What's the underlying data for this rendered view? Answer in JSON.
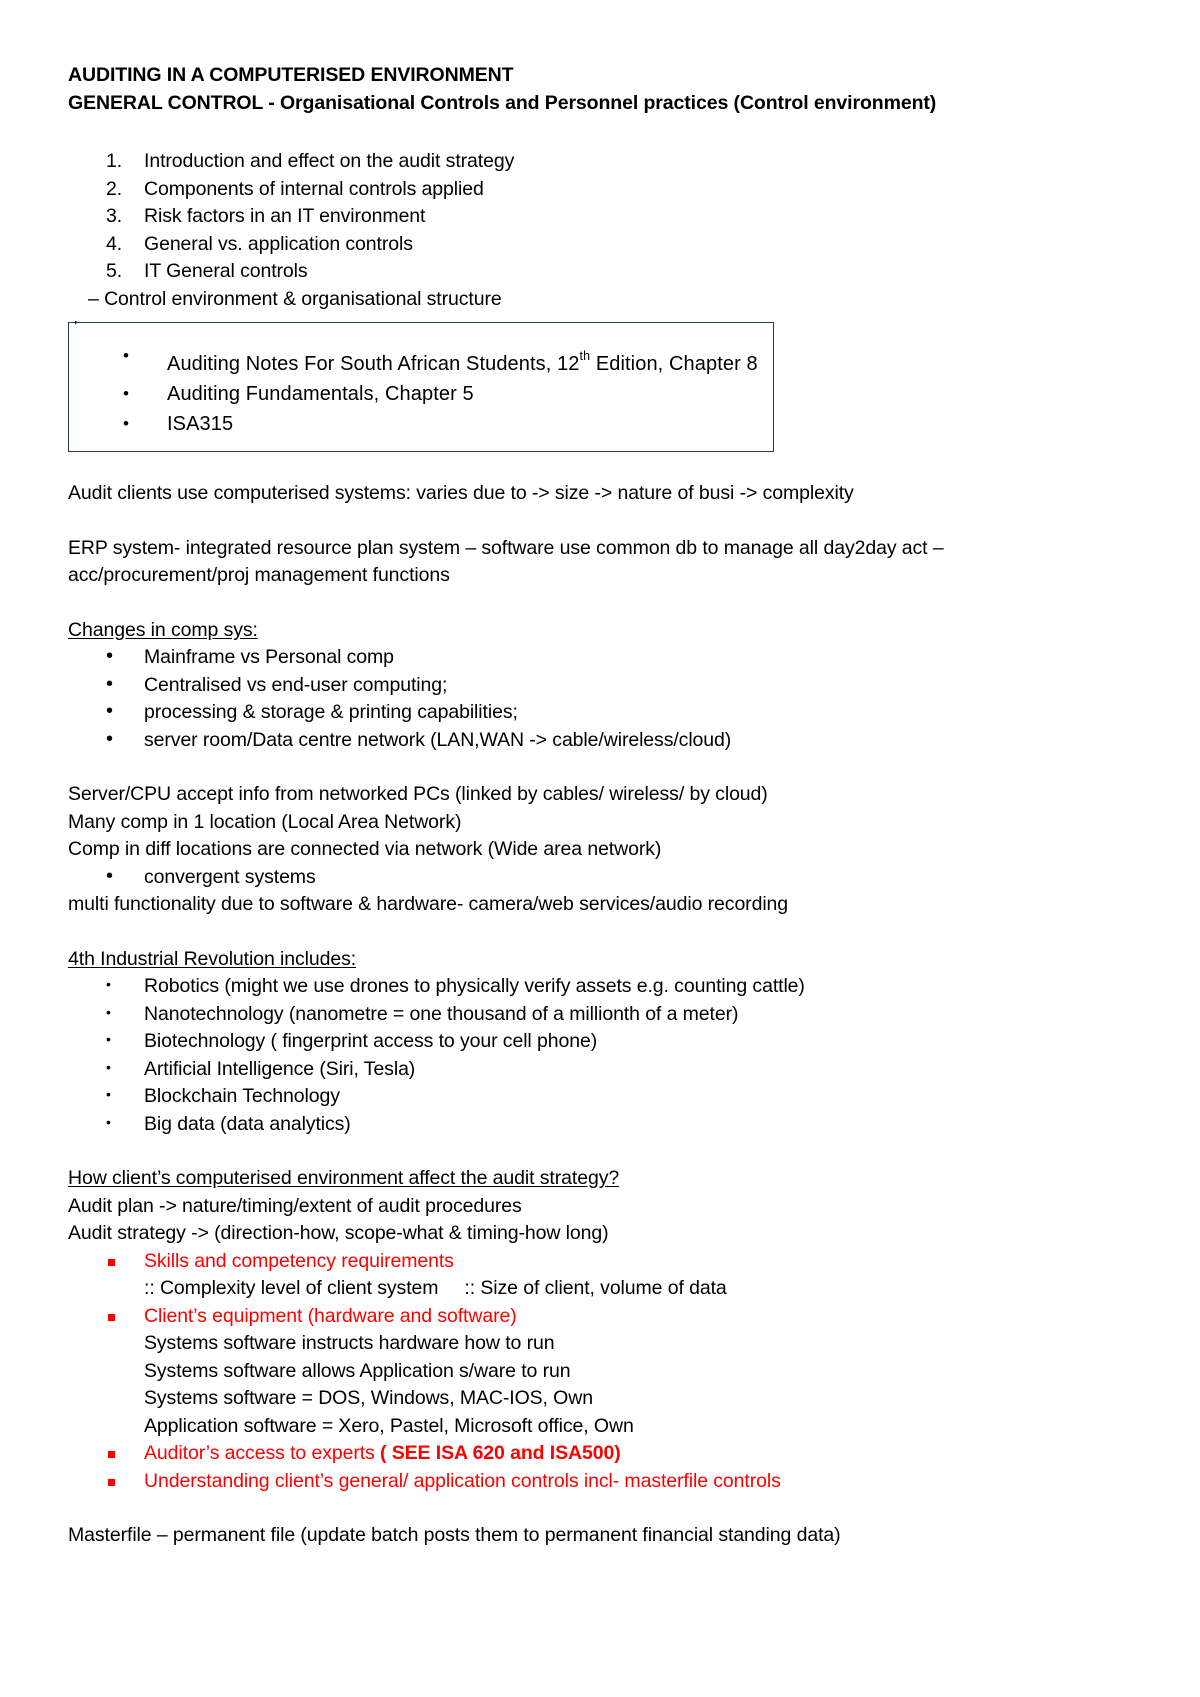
{
  "document": {
    "title_line_1": "AUDITING IN A COMPUTERISED ENVIRONMENT",
    "title_line_2": "GENERAL CONTROL - Organisational Controls and Personnel practices (Control environment)",
    "agenda": {
      "items": [
        "Introduction and effect on the audit strategy",
        "Components of internal controls applied",
        "Risk factors in an IT environment",
        "General vs. application controls",
        "IT General controls"
      ],
      "dash_item": "– Control environment & organisational structure"
    },
    "reference_box": {
      "tick_mark": "’",
      "item_1_prefix": "Auditing Notes For South African Students, 12",
      "item_1_ordinal": "th",
      "item_1_suffix": " Edition, Chapter 8",
      "item_2": "Auditing Fundamentals, Chapter 5",
      "item_3": "ISA315"
    },
    "intro_paragraph": "Audit clients use computerised systems: varies due to -> size -> nature of busi -> complexity",
    "erp_paragraph_line_1": "ERP system- integrated resource plan system – software use common db to manage all day2day act –",
    "erp_paragraph_line_2": "acc/procurement/proj management functions",
    "changes_section": {
      "heading": "Changes in comp sys:",
      "bullets": [
        "Mainframe vs Personal comp",
        "Centralised vs end-user computing;",
        "processing & storage & printing capabilities;",
        "server room/Data centre network (LAN,WAN -> cable/wireless/cloud)"
      ]
    },
    "network_lines": {
      "line_1": "Server/CPU accept info from networked PCs (linked by cables/ wireless/ by cloud)",
      "line_2": "Many comp in 1 location (Local Area Network)",
      "line_3": "Comp in diff locations are connected via network (Wide area network)",
      "bullet_1": "convergent systems",
      "line_4": "multi functionality due to software & hardware- camera/web services/audio recording"
    },
    "fourth_ir": {
      "heading": "4th Industrial Revolution includes:",
      "bullets": [
        "Robotics (might we use drones to physically verify assets e.g. counting cattle)",
        "Nanotechnology (nanometre = one thousand of a millionth of a meter)",
        "Biotechnology ( fingerprint access to your cell phone)",
        "Artificial Intelligence (Siri, Tesla)",
        "Blockchain Technology",
        "Big data (data analytics)"
      ]
    },
    "audit_strategy": {
      "heading": "How client’s computerised environment affect the audit strategy?",
      "line_1": "Audit plan -> nature/timing/extent of audit procedures",
      "line_2": "Audit strategy -> (direction-how, scope-what & timing-how long)",
      "red_item_1": "Skills and competency requirements",
      "sub_1_a": ":: Complexity level of client system",
      "sub_1_b": ":: Size of client, volume of data",
      "red_item_2": "Client’s equipment (hardware and software)",
      "sub_2_lines": [
        "Systems software instructs hardware how to run",
        "Systems software allows Application s/ware to run",
        "Systems software = DOS, Windows, MAC-IOS, Own",
        "Application software = Xero, Pastel, Microsoft office, Own"
      ],
      "red_item_3_normal": "Auditor’s access to experts ",
      "red_item_3_bold": "( SEE ISA 620 and ISA500)",
      "red_item_4": "Understanding client’s general/ application controls incl- masterfile controls"
    },
    "masterfile_line": "Masterfile – permanent file (update batch posts them to permanent financial standing data)",
    "colors": {
      "red_accent": "#ff0000",
      "box_border": "#1f3864",
      "text": "#000000"
    }
  }
}
